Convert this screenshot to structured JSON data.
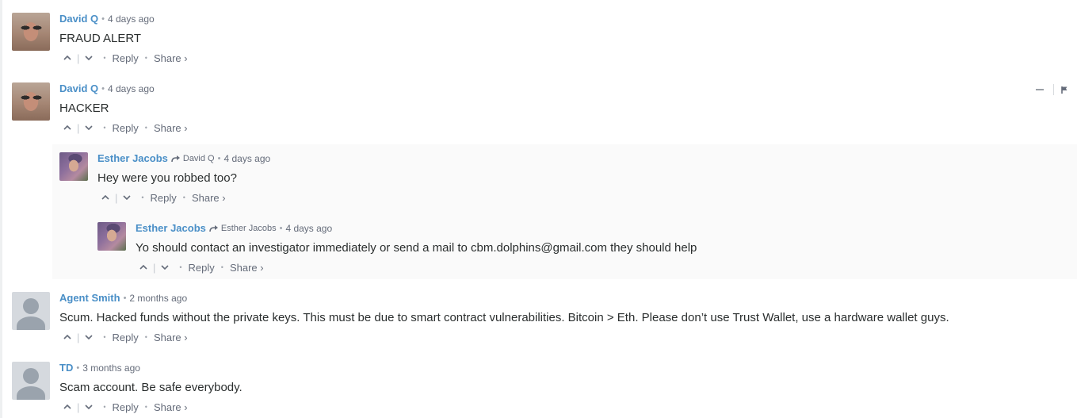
{
  "comments": [
    {
      "author": "David Q",
      "time": "4 days ago",
      "text": "FRAUD ALERT",
      "avatar": "david-photo",
      "reply_label": "Reply",
      "share_label": "Share ›"
    },
    {
      "author": "David Q",
      "time": "4 days ago",
      "text": "HACKER",
      "avatar": "david-photo",
      "reply_label": "Reply",
      "share_label": "Share ›"
    },
    {
      "author": "Esther Jacobs",
      "in_reply_to": "David Q",
      "time": "4 days ago",
      "text": "Hey were you robbed too?",
      "avatar": "esther-photo",
      "reply_label": "Reply",
      "share_label": "Share ›"
    },
    {
      "author": "Esther Jacobs",
      "in_reply_to": "Esther Jacobs",
      "time": "4 days ago",
      "text": "Yo should contact an investigator immediately or send a mail to cbm.dolphins@gmail.com they should help",
      "avatar": "esther-photo",
      "reply_label": "Reply",
      "share_label": "Share ›"
    },
    {
      "author": "Agent Smith",
      "time": "2 months ago",
      "text": "Scum. Hacked funds without the private keys. This must be due to smart contract vulnerabilities. Bitcoin > Eth. Please don’t use Trust Wallet, use a hardware wallet guys.",
      "avatar": "default-avatar",
      "reply_label": "Reply",
      "share_label": "Share ›"
    },
    {
      "author": "TD",
      "time": "3 months ago",
      "text": "Scam account. Be safe everybody.",
      "avatar": "default-avatar",
      "reply_label": "Reply",
      "share_label": "Share ›"
    }
  ],
  "icons": {
    "upvote": "chevron-up-icon",
    "downvote": "chevron-down-icon",
    "reply_to": "reply-arrow-icon",
    "minimize": "minimize-icon",
    "flag": "flag-icon"
  },
  "colors": {
    "author": "#4a8fc7",
    "meta": "#656c7a",
    "text": "#2a2e2e",
    "thread_background": "#fafafa"
  }
}
